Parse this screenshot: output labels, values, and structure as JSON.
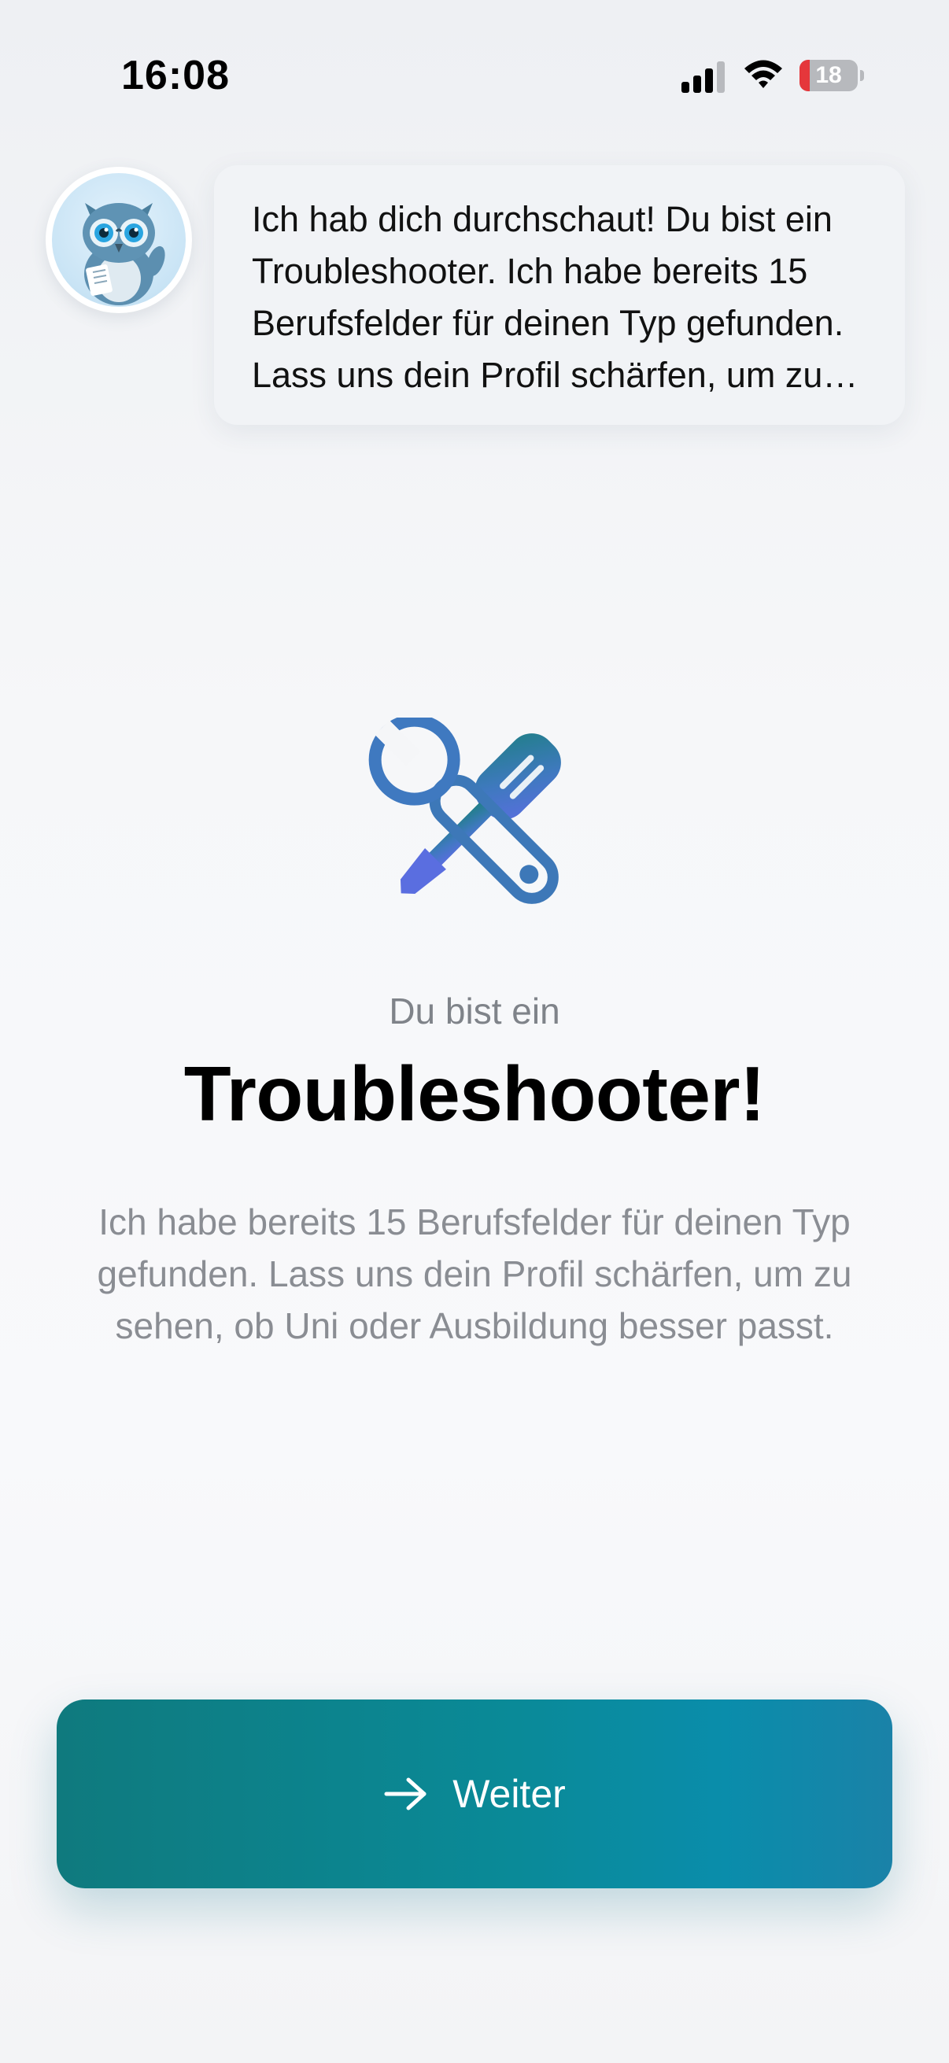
{
  "status_bar": {
    "time": "16:08",
    "battery_level": "18",
    "battery_fraction": 0.18,
    "icons": [
      "signal-icon",
      "wifi-icon",
      "battery-icon"
    ],
    "battery_low_color": "#e5373b"
  },
  "assistant": {
    "avatar_icon": "owl-mascot-icon",
    "message": "Ich hab dich durchschaut! Du bist ein Troubleshooter. Ich habe bereits 15 Berufsfelder für deinen Typ gefunden. Lass uns dein Profil schärfen, um zu sehen, ob Uni oder Ausbildung besser passt."
  },
  "result": {
    "icon": "wrench-screwdriver-icon",
    "subtitle": "Du bist ein",
    "title": "Troubleshooter!",
    "description": "Ich habe bereits 15 Berufsfelder für deinen Typ gefunden. Lass uns dein Profil schärfen, um zu sehen, ob Uni oder Ausbildung besser passt."
  },
  "actions": {
    "continue_label": "Weiter",
    "continue_icon": "arrow-right-icon"
  },
  "colors": {
    "accent_teal": "#0f7a7e",
    "accent_blue": "#0a8dab",
    "icon_gradient_start": "#1f7f86",
    "icon_gradient_end": "#5a6ee0"
  }
}
